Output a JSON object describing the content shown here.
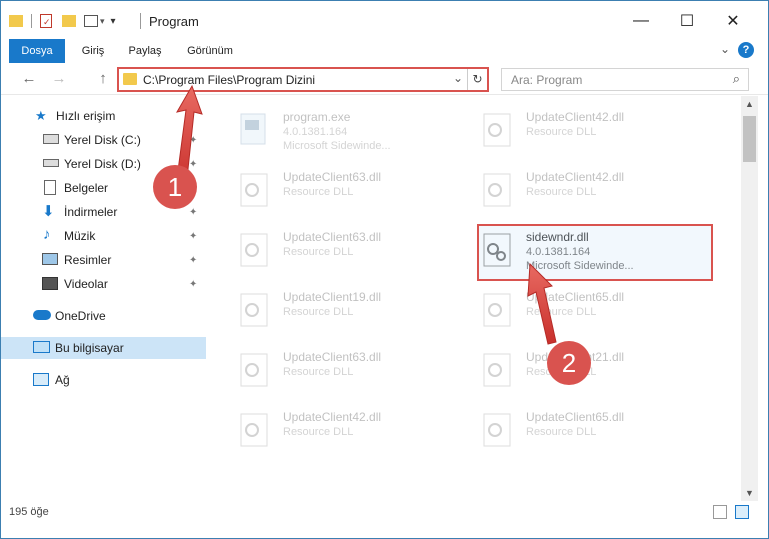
{
  "window": {
    "title": "Program",
    "controls": {
      "minimize": "—",
      "maximize": "☐",
      "close": "✕"
    }
  },
  "ribbon": {
    "tabs": [
      "Dosya",
      "Giriş",
      "Paylaş",
      "Görünüm"
    ],
    "help": "?",
    "collapse": "⌄"
  },
  "navigation": {
    "back": "←",
    "forward": "→",
    "up": "↑",
    "address": "C:\\Program Files\\Program Dizini",
    "dropdown": "⌄",
    "refresh": "↻",
    "search_placeholder": "Ara: Program",
    "search_icon": "⌕"
  },
  "sidebar": {
    "items": [
      {
        "label": "Hızlı erişim",
        "icon": "star-icon",
        "pinned": false
      },
      {
        "label": "Yerel Disk (C:)",
        "icon": "drive-icon",
        "pinned": true
      },
      {
        "label": "Yerel Disk (D:)",
        "icon": "drive-icon",
        "pinned": true
      },
      {
        "label": "Belgeler",
        "icon": "documents-icon",
        "pinned": true
      },
      {
        "label": "İndirmeler",
        "icon": "download-icon",
        "pinned": true
      },
      {
        "label": "Müzik",
        "icon": "music-icon",
        "pinned": true
      },
      {
        "label": "Resimler",
        "icon": "pictures-icon",
        "pinned": true
      },
      {
        "label": "Videolar",
        "icon": "video-icon",
        "pinned": true
      },
      {
        "label": "OneDrive",
        "icon": "cloud-icon",
        "pinned": false
      },
      {
        "label": "Bu bilgisayar",
        "icon": "computer-icon",
        "pinned": false,
        "selected": true
      },
      {
        "label": "Ağ",
        "icon": "network-icon",
        "pinned": false
      }
    ],
    "pin_glyph": "📌"
  },
  "files": [
    {
      "name": "program.exe",
      "line2": "4.0.1381.164",
      "line3": "Microsoft Sidewinde...",
      "kind": "exe",
      "faded": true
    },
    {
      "name": "UpdateClient42.dll",
      "line2": "Resource DLL",
      "line3": "",
      "kind": "dll",
      "faded": true
    },
    {
      "name": "UpdateClient63.dll",
      "line2": "Resource DLL",
      "line3": "",
      "kind": "dll",
      "faded": true
    },
    {
      "name": "UpdateClient42.dll",
      "line2": "Resource DLL",
      "line3": "",
      "kind": "dll",
      "faded": true
    },
    {
      "name": "UpdateClient63.dll",
      "line2": "Resource DLL",
      "line3": "",
      "kind": "dll",
      "faded": true
    },
    {
      "name": "sidewndr.dll",
      "line2": "4.0.1381.164",
      "line3": "Microsoft Sidewinde...",
      "kind": "dll",
      "faded": false
    },
    {
      "name": "UpdateClient19.dll",
      "line2": "Resource DLL",
      "line3": "",
      "kind": "dll",
      "faded": true
    },
    {
      "name": "UpdateClient65.dll",
      "line2": "Resource DLL",
      "line3": "",
      "kind": "dll",
      "faded": true
    },
    {
      "name": "UpdateClient63.dll",
      "line2": "Resource DLL",
      "line3": "",
      "kind": "dll",
      "faded": true
    },
    {
      "name": "UpdateClient21.dll",
      "line2": "Resource DLL",
      "line3": "",
      "kind": "dll",
      "faded": true
    },
    {
      "name": "UpdateClient42.dll",
      "line2": "Resource DLL",
      "line3": "",
      "kind": "dll",
      "faded": true
    },
    {
      "name": "UpdateClient65.dll",
      "line2": "Resource DLL",
      "line3": "",
      "kind": "dll",
      "faded": true
    }
  ],
  "status": {
    "item_count": "195 öğe"
  },
  "annotations": {
    "step1": "1",
    "step2": "2",
    "color": "#d9534f"
  },
  "colors": {
    "accent": "#1979ca",
    "selection": "#cce4f7",
    "highlight": "#d9534f"
  }
}
